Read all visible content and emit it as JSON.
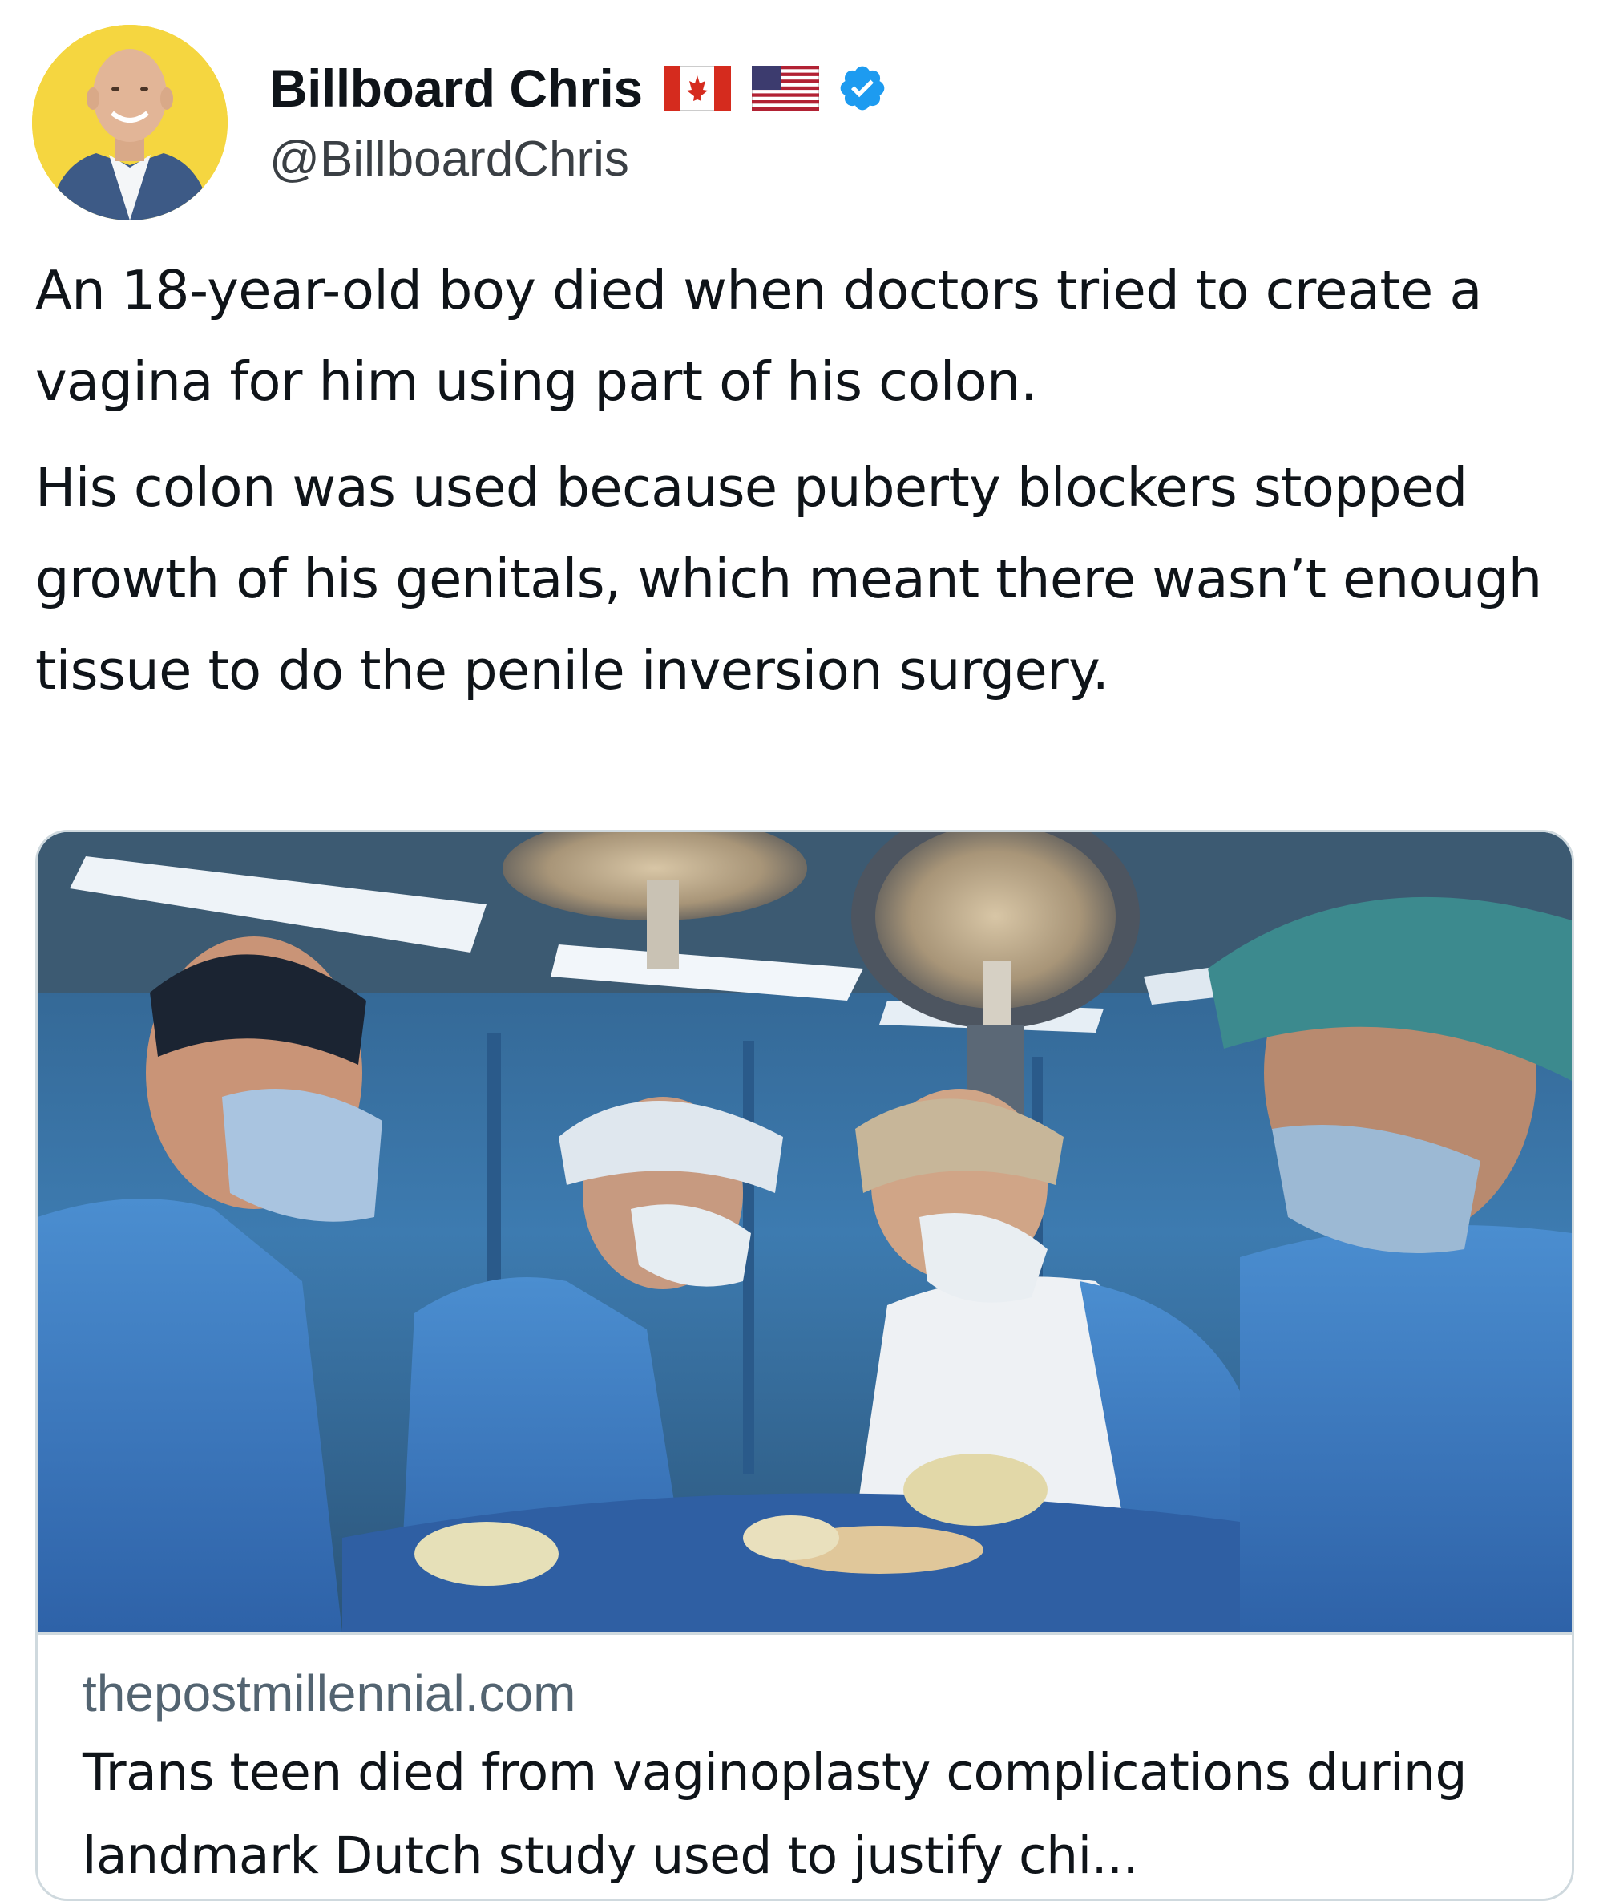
{
  "author": {
    "display_name": "Billboard Chris",
    "handle": "@BillboardChris",
    "flags": [
      "canada-flag-icon",
      "usa-flag-icon"
    ],
    "verified": true,
    "verified_color": "#1d9bf0",
    "avatar_bg": "#f5d640"
  },
  "tweet": {
    "paragraphs": [
      "An 18-year-old boy died when doctors tried to create a vagina for him using part of his colon.",
      "His colon was used because puberty blockers stopped growth of his genitals, which meant there wasn’t enough tissue to do the penile inversion surgery."
    ]
  },
  "link_card": {
    "image": "surgery-photo",
    "domain": "thepostmillennial.com",
    "title": "Trans teen died from vaginoplasty complications during landmark Dutch study used to justify chi..."
  }
}
